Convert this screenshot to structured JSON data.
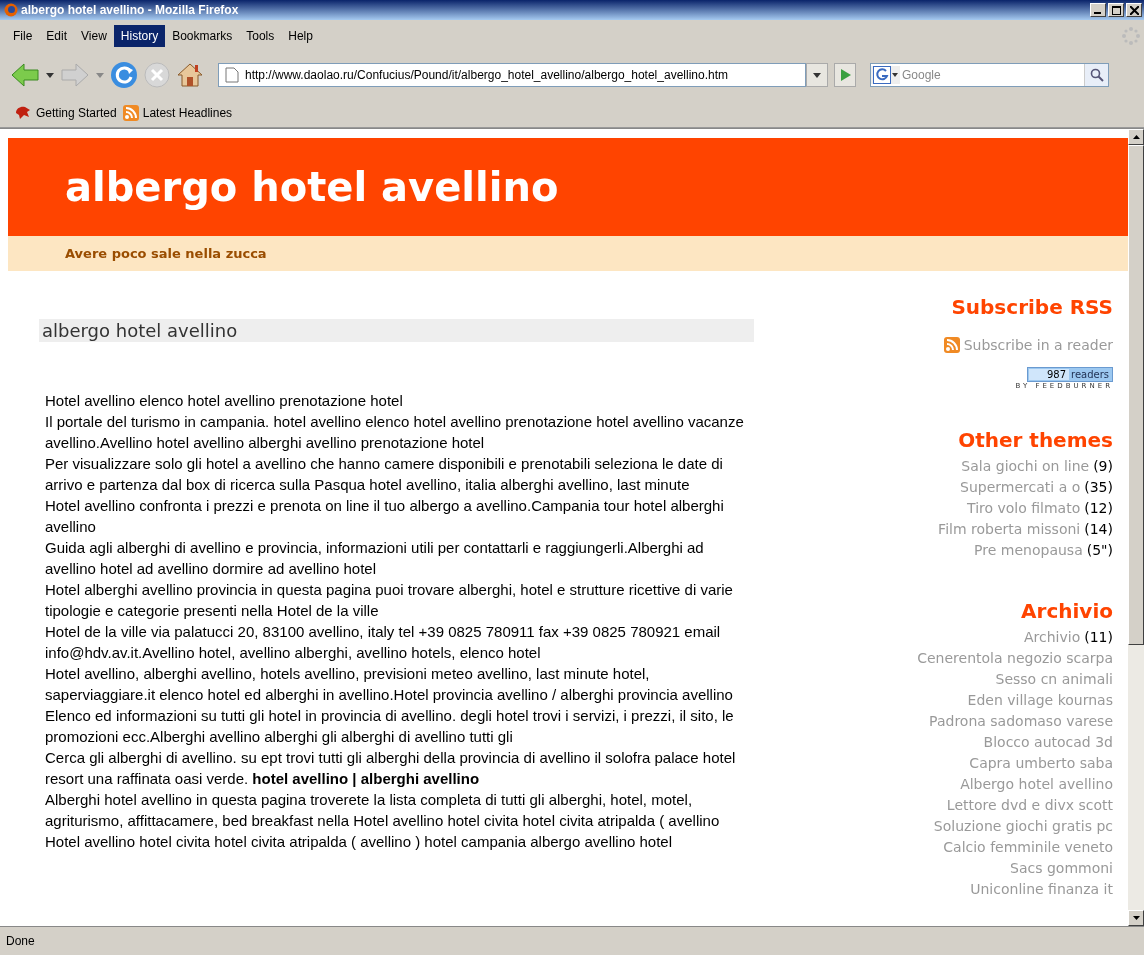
{
  "window": {
    "title": "albergo hotel avellino - Mozilla Firefox"
  },
  "menu": [
    {
      "label": "File",
      "selected": false
    },
    {
      "label": "Edit",
      "selected": false
    },
    {
      "label": "View",
      "selected": false
    },
    {
      "label": "History",
      "selected": true
    },
    {
      "label": "Bookmarks",
      "selected": false
    },
    {
      "label": "Tools",
      "selected": false
    },
    {
      "label": "Help",
      "selected": false
    }
  ],
  "address": {
    "value": "http://www.daolao.ru/Confucius/Pound/it/albergo_hotel_avellino/albergo_hotel_avellino.htm"
  },
  "search": {
    "placeholder": "Google"
  },
  "bookmarks": [
    "Getting Started",
    "Latest Headlines"
  ],
  "page": {
    "site_title": "albergo hotel avellino",
    "tagline": "Avere poco sale nella zucca",
    "post_title": "albergo hotel avellino",
    "paragraphs": [
      "Hotel avellino elenco hotel avellino prenotazione hotel",
      "Il portale del turismo in campania. hotel avellino elenco hotel avellino prenotazione hotel avellino vacanze avellino.Avellino hotel avellino alberghi avellino prenotazione hotel",
      "Per visualizzare solo gli hotel a avellino che hanno camere disponibili e prenotabili seleziona le date di arrivo e partenza dal box di ricerca sulla Pasqua hotel avellino, italia alberghi avellino, last minute",
      "Hotel avellino confronta i prezzi e prenota on line il tuo albergo a avellino.Campania tour hotel alberghi avellino",
      "Guida agli alberghi di avellino e provincia, informazioni utili per contattarli e raggiungerli.Alberghi ad avellino hotel ad avellino dormire ad avellino hotel",
      "Hotel alberghi avellino provincia in questa pagina puoi trovare alberghi, hotel e strutture ricettive di varie tipologie e categorie presenti nella Hotel de la ville",
      "Hotel de la ville via palatucci 20, 83100 avellino, italy tel +39 0825 780911 fax +39 0825 780921 email info@hdv.av.it.Avellino hotel, avellino alberghi, avellino hotels, elenco hotel",
      "Hotel avellino, alberghi avellino, hotels avellino, previsioni meteo avellino, last minute hotel, saperviaggiare.it elenco hotel ed alberghi in avellino.Hotel provincia avellino / alberghi provincia avellino",
      "Elenco ed informazioni su tutti gli hotel in provincia di avellino. degli hotel trovi i servizi, i prezzi, il sito, le promozioni ecc.Alberghi avellino alberghi gli alberghi di avellino tutti gli",
      "Cerca gli alberghi di avellino. su ept trovi tutti gli alberghi della provincia di avellino il solofra palace hotel resort una raffinata oasi verde. **hotel avellino | alberghi avellino**",
      "Alberghi hotel avellino in questa pagina troverete la lista completa di tutti gli alberghi, hotel, motel, agriturismo, affittacamere, bed breakfast nella Hotel avellino hotel civita hotel civita atripalda ( avellino",
      "Hotel avellino hotel civita hotel civita atripalda ( avellino ) hotel campania albergo avellino hotel"
    ]
  },
  "sidebar": {
    "rss_heading": "Subscribe RSS",
    "rss_link": "Subscribe in a reader",
    "readers_count": "987",
    "readers_label": "readers",
    "feedburner": "BY FEEDBURNER",
    "themes_heading": "Other themes",
    "themes": [
      {
        "name": "Sala giochi on line",
        "count": "(9)"
      },
      {
        "name": "Supermercati a o",
        "count": "(35)"
      },
      {
        "name": "Tiro volo filmato",
        "count": "(12)"
      },
      {
        "name": "Film roberta missoni",
        "count": "(14)"
      },
      {
        "name": "Pre menopausa",
        "count": "(5\")"
      }
    ],
    "archive_heading": "Archivio",
    "archive": [
      {
        "name": "Archivio",
        "count": "(11)"
      },
      {
        "name": "Cenerentola negozio scarpa"
      },
      {
        "name": "Sesso cn animali"
      },
      {
        "name": "Eden village kournas"
      },
      {
        "name": "Padrona sadomaso varese"
      },
      {
        "name": "Blocco autocad 3d"
      },
      {
        "name": "Capra umberto saba"
      },
      {
        "name": "Albergo hotel avellino"
      },
      {
        "name": "Lettore dvd e divx scott"
      },
      {
        "name": "Soluzione giochi gratis pc"
      },
      {
        "name": "Calcio femminile veneto"
      },
      {
        "name": "Sacs gommoni"
      },
      {
        "name": "Uniconline finanza it"
      }
    ]
  },
  "status_bar": "Done"
}
